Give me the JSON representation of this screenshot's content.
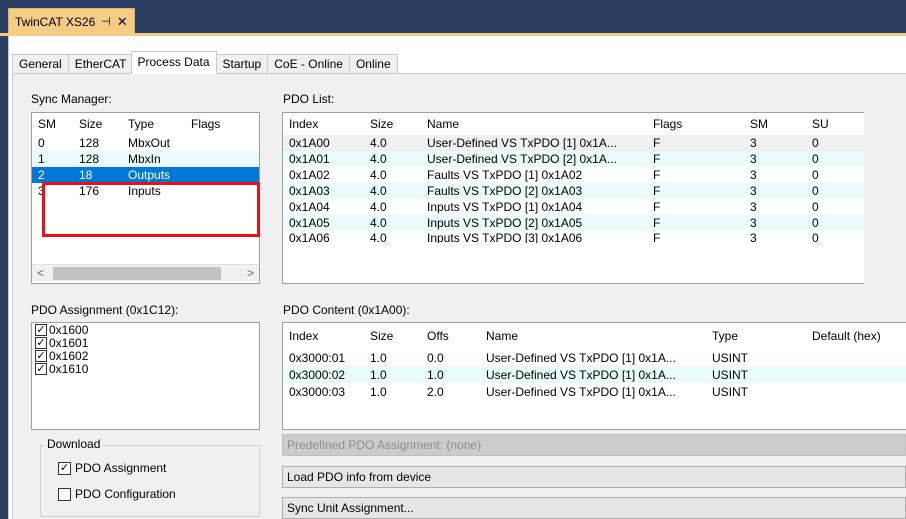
{
  "document_tab": {
    "title": "TwinCAT XS26",
    "pin_glyph": "⊣",
    "close_glyph": "✕"
  },
  "tabs": [
    "General",
    "EtherCAT",
    "Process Data",
    "Startup",
    "CoE - Online",
    "Online"
  ],
  "active_tab": "Process Data",
  "sync_manager": {
    "label": "Sync Manager:",
    "columns": [
      "SM",
      "Size",
      "Type",
      "Flags"
    ],
    "rows": [
      {
        "sm": "0",
        "size": "128",
        "type": "MbxOut",
        "flags": "",
        "state": "normal"
      },
      {
        "sm": "1",
        "size": "128",
        "type": "MbxIn",
        "flags": "",
        "state": "alt"
      },
      {
        "sm": "2",
        "size": "18",
        "type": "Outputs",
        "flags": "",
        "state": "selected"
      },
      {
        "sm": "3",
        "size": "176",
        "type": "Inputs",
        "flags": "",
        "state": "normal"
      }
    ]
  },
  "pdo_list": {
    "label": "PDO List:",
    "columns": [
      "Index",
      "Size",
      "Name",
      "Flags",
      "SM",
      "SU"
    ],
    "rows": [
      {
        "index": "0x1A00",
        "size": "4.0",
        "name": "User-Defined VS TxPDO [1] 0x1A...",
        "flags": "F",
        "sm": "3",
        "su": "0",
        "state": "grey"
      },
      {
        "index": "0x1A01",
        "size": "4.0",
        "name": "User-Defined VS TxPDO [2] 0x1A...",
        "flags": "F",
        "sm": "3",
        "su": "0",
        "state": "alt"
      },
      {
        "index": "0x1A02",
        "size": "4.0",
        "name": "Faults VS TxPDO [1] 0x1A02",
        "flags": "F",
        "sm": "3",
        "su": "0",
        "state": "normal"
      },
      {
        "index": "0x1A03",
        "size": "4.0",
        "name": "Faults VS TxPDO [2] 0x1A03",
        "flags": "F",
        "sm": "3",
        "su": "0",
        "state": "alt"
      },
      {
        "index": "0x1A04",
        "size": "4.0",
        "name": "Inputs VS TxPDO [1] 0x1A04",
        "flags": "F",
        "sm": "3",
        "su": "0",
        "state": "normal"
      },
      {
        "index": "0x1A05",
        "size": "4.0",
        "name": "Inputs VS TxPDO [2] 0x1A05",
        "flags": "F",
        "sm": "3",
        "su": "0",
        "state": "alt"
      },
      {
        "index": "0x1A06",
        "size": "4.0",
        "name": "Inputs VS TxPDO [3] 0x1A06",
        "flags": "F",
        "sm": "3",
        "su": "0",
        "state": "normal"
      }
    ]
  },
  "pdo_assignment": {
    "label": "PDO Assignment (0x1C12):",
    "items": [
      {
        "label": "0x1600",
        "checked": true
      },
      {
        "label": "0x1601",
        "checked": true
      },
      {
        "label": "0x1602",
        "checked": true
      },
      {
        "label": "0x1610",
        "checked": true
      }
    ]
  },
  "pdo_content": {
    "label": "PDO Content (0x1A00):",
    "columns": [
      "Index",
      "Size",
      "Offs",
      "Name",
      "Type",
      "Default (hex)"
    ],
    "rows": [
      {
        "index": "0x3000:01",
        "size": "1.0",
        "offs": "0.0",
        "name": "User-Defined VS TxPDO [1] 0x1A...",
        "type": "USINT",
        "default": "",
        "state": "normal"
      },
      {
        "index": "0x3000:02",
        "size": "1.0",
        "offs": "1.0",
        "name": "User-Defined VS TxPDO [1] 0x1A...",
        "type": "USINT",
        "default": "",
        "state": "alt"
      },
      {
        "index": "0x3000:03",
        "size": "1.0",
        "offs": "2.0",
        "name": "User-Defined VS TxPDO [1] 0x1A...",
        "type": "USINT",
        "default": "",
        "state": "normal"
      }
    ]
  },
  "download": {
    "legend": "Download",
    "pdo_assignment_label": "PDO Assignment",
    "pdo_assignment_checked": true,
    "pdo_configuration_label": "PDO Configuration",
    "pdo_configuration_checked": false
  },
  "buttons": {
    "predefined": "Predefined PDO Assignment: (none)",
    "load_pdo": "Load PDO info from device",
    "sync_unit": "Sync Unit Assignment..."
  },
  "colors": {
    "selection": "#0078d7",
    "highlight_box": "#e8101a",
    "alt_row": "#e9fbfb",
    "doc_tab": "#f5cc84"
  }
}
